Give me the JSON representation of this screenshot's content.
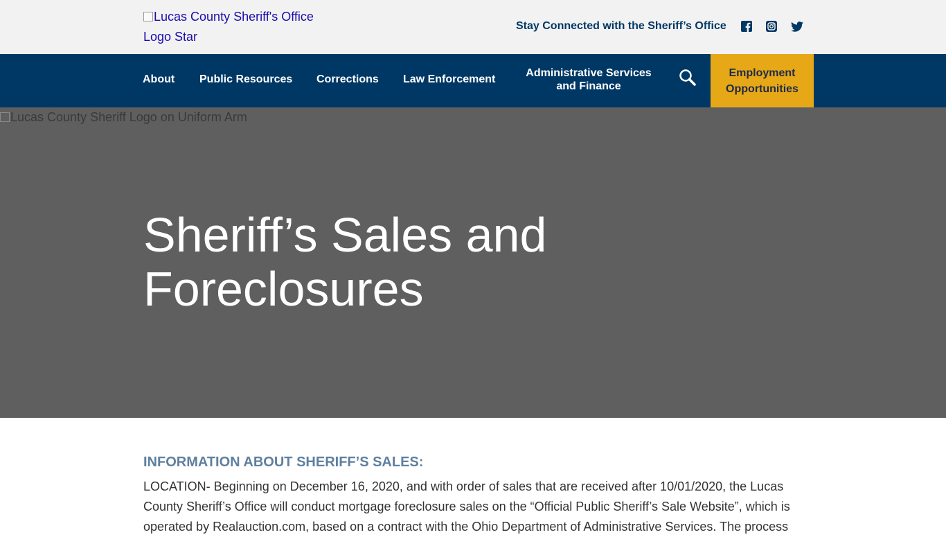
{
  "header": {
    "logo_alt_line1": "Lucas County Sheriff's Office",
    "logo_alt_line2": "Logo Star",
    "stay_connected": "Stay Connected with the Sheriff’s Office",
    "social_icons": [
      "facebook-icon",
      "instagram-icon",
      "twitter-icon"
    ]
  },
  "nav": {
    "items": [
      {
        "label": "About"
      },
      {
        "label": "Public Resources"
      },
      {
        "label": "Corrections"
      },
      {
        "label": "Law Enforcement"
      },
      {
        "label_line1": "Administrative Services",
        "label_line2": "and Finance"
      }
    ],
    "search_icon": "search-icon",
    "employment_line1": "Employment",
    "employment_line2": "Opportunities"
  },
  "hero": {
    "image_alt": "Lucas County Sheriff Logo on Uniform Arm",
    "title_line1": "Sheriff’s Sales and",
    "title_line2": "Foreclosures"
  },
  "main": {
    "section_heading": "INFORMATION ABOUT SHERIFF’S SALES:",
    "paragraph": "LOCATION- Beginning on December 16, 2020, and with order of sales that are received after 10/01/2020, the Lucas County Sheriff’s Office will conduct mortgage foreclosure sales on the “Official Public Sheriff’s Sale Website”, which is operated by Realauction.com, based on a contract with the Ohio Department of Administrative Services. The process"
  },
  "colors": {
    "navy": "#003865",
    "gold": "#e6a817",
    "hero_gray": "#5f5f5f",
    "heading_blue": "#5f7f9f"
  }
}
